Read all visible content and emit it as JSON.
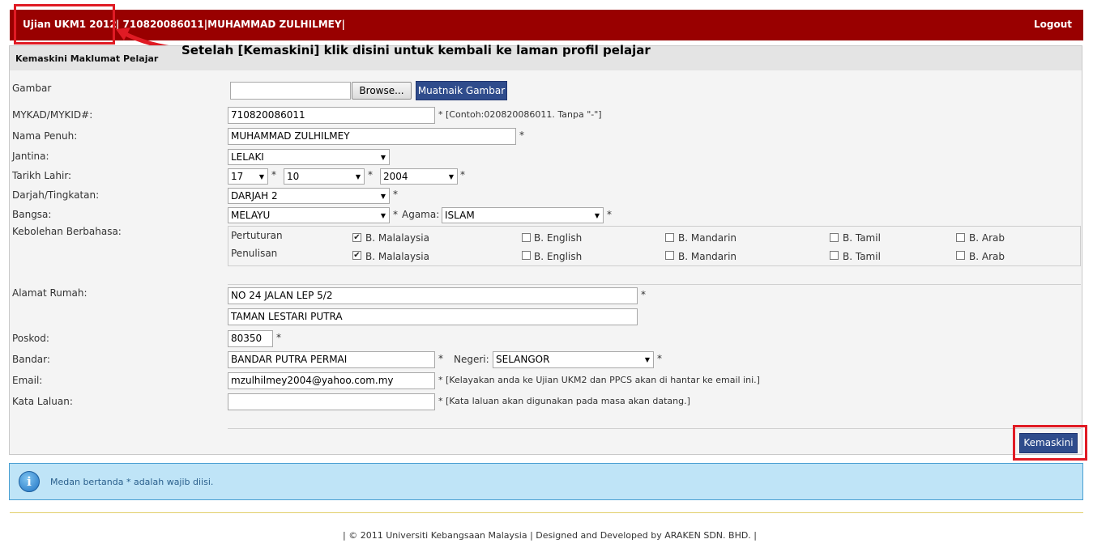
{
  "header": {
    "app_title": "Ujian UKM1 2012",
    "user_info": "| 710820086011|MUHAMMAD ZULHILMEY|",
    "logout_label": "Logout"
  },
  "annotation": {
    "text": "Setelah [Kemaskini] klik disini untuk kembali ke laman profil pelajar",
    "highlight_color": "#e01b24"
  },
  "panel": {
    "title": "Kemaskini Maklumat Pelajar"
  },
  "form": {
    "gambar": {
      "label": "Gambar",
      "value": "",
      "browse_label": "Browse...",
      "upload_label": "Muatnaik Gambar"
    },
    "mykad": {
      "label": "MYKAD/MYKID#:",
      "value": "710820086011",
      "note": "* [Contoh:020820086011. Tanpa \"-\"]"
    },
    "nama": {
      "label": "Nama Penuh:",
      "value": "MUHAMMAD ZULHILMEY",
      "req": "*"
    },
    "jantina": {
      "label": "Jantina:",
      "value": "LELAKI"
    },
    "tarikh": {
      "label": "Tarikh Lahir:",
      "day": "17",
      "month": "10",
      "year": "2004",
      "req": "*"
    },
    "darjah": {
      "label": "Darjah/Tingkatan:",
      "value": "DARJAH 2",
      "req": "*"
    },
    "bangsa": {
      "label": "Bangsa:",
      "value": "MELAYU",
      "req": "*"
    },
    "agama": {
      "label": "Agama:",
      "value": "ISLAM",
      "req": "*"
    },
    "bahasa": {
      "label": "Kebolehan Berbahasa:",
      "rows": [
        {
          "label": "Pertuturan",
          "options": [
            {
              "label": "B. Malalaysia",
              "checked": true
            },
            {
              "label": "B. English",
              "checked": false
            },
            {
              "label": "B. Mandarin",
              "checked": false
            },
            {
              "label": "B. Tamil",
              "checked": false
            },
            {
              "label": "B. Arab",
              "checked": false
            }
          ]
        },
        {
          "label": "Penulisan",
          "options": [
            {
              "label": "B. Malalaysia",
              "checked": true
            },
            {
              "label": "B. English",
              "checked": false
            },
            {
              "label": "B. Mandarin",
              "checked": false
            },
            {
              "label": "B. Tamil",
              "checked": false
            },
            {
              "label": "B. Arab",
              "checked": false
            }
          ]
        }
      ]
    },
    "alamat": {
      "label": "Alamat Rumah:",
      "line1": "NO 24 JALAN LEP 5/2",
      "line2": "TAMAN LESTARI PUTRA",
      "req": "*"
    },
    "poskod": {
      "label": "Poskod:",
      "value": "80350",
      "req": "*"
    },
    "bandar": {
      "label": "Bandar:",
      "value": "BANDAR PUTRA PERMAI",
      "req": "*"
    },
    "negeri": {
      "label": "Negeri:",
      "value": "SELANGOR",
      "req": "*"
    },
    "email": {
      "label": "Email:",
      "value": "mzulhilmey2004@yahoo.com.my",
      "note": "* [Kelayakan anda ke Ujian UKM2 dan PPCS akan di hantar ke email ini.]"
    },
    "kata": {
      "label": "Kata Laluan:",
      "value": "",
      "note": "* [Kata laluan akan digunakan pada masa akan datang.]"
    },
    "submit_label": "Kemaskini"
  },
  "info": {
    "text": "Medan bertanda * adalah wajib diisi."
  },
  "footer": {
    "text": "| © 2011 Universiti Kebangsaan Malaysia | Designed and Developed by ARAKEN SDN. BHD. |"
  },
  "colors": {
    "header_bg": "#990000",
    "button_blue": "#2f4c8c",
    "info_bg": "#bfe4f7"
  }
}
